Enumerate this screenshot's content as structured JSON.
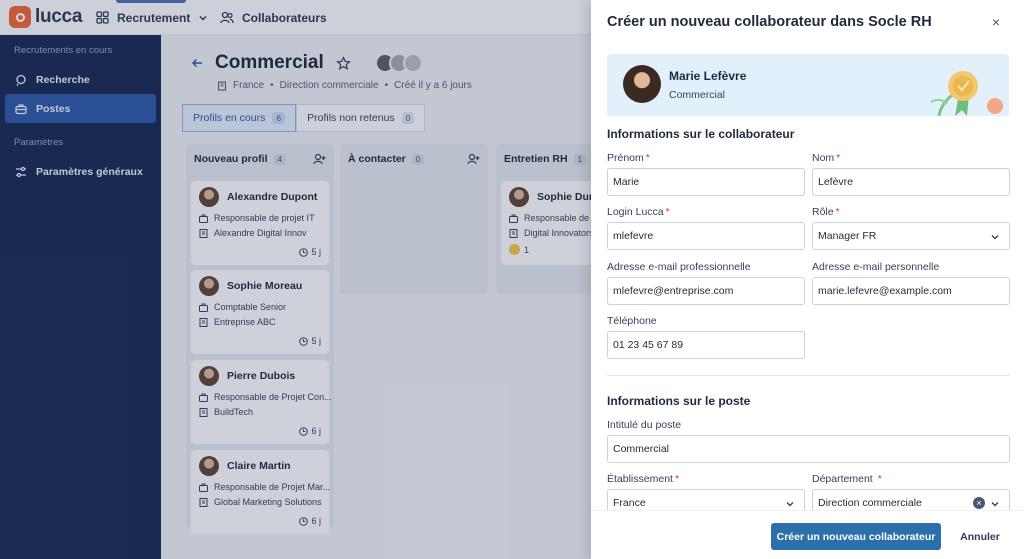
{
  "topbar": {
    "logo_text": "lucca",
    "nav_recruitment": "Recrutement",
    "nav_collaborators": "Collaborateurs"
  },
  "sidebar": {
    "section_1": "Recrutements en cours",
    "items_1": [
      {
        "label": "Recherche",
        "icon": "search-icon"
      },
      {
        "label": "Postes",
        "icon": "briefcase-icon",
        "active": true
      }
    ],
    "section_2": "Paramètres",
    "items_2": [
      {
        "label": "Paramètres généraux",
        "icon": "settings-icon"
      }
    ]
  },
  "page": {
    "title": "Commercial",
    "sub_country": "France",
    "sub_department": "Direction commerciale",
    "sub_created": "Créé il y a 6 jours",
    "tabs": [
      {
        "label": "Profils en cours",
        "count": "6"
      },
      {
        "label": "Profils non retenus",
        "count": "0"
      }
    ]
  },
  "board": {
    "columns": [
      {
        "title": "Nouveau profil",
        "count": "4"
      },
      {
        "title": "À contacter",
        "count": "0"
      },
      {
        "title": "Entretien RH",
        "count": "1"
      }
    ],
    "cards": [
      {
        "name": "Alexandre Dupont",
        "role": "Responsable de projet IT",
        "company": "Alexandre Digital Innov",
        "duration": "5 j"
      },
      {
        "name": "Sophie Moreau",
        "role": "Comptable Senior",
        "company": "Entreprise ABC",
        "duration": "5 j"
      },
      {
        "name": "Pierre Dubois",
        "role": "Responsable de Projet Con...",
        "company": "BuildTech",
        "duration": "6 j"
      },
      {
        "name": "Claire Martin",
        "role": "Responsable de Projet Mar...",
        "company": "Global Marketing Solutions",
        "duration": "6 j"
      },
      {
        "name": "Sophie Dura",
        "role": "Responsable de P",
        "company": "Digital Innovators",
        "reaction_count": "1"
      }
    ]
  },
  "panel": {
    "title": "Créer un nouveau collaborateur dans Socle RH",
    "banner_name": "Marie Lefèvre",
    "banner_position": "Commercial",
    "section_employee": "Informations sur le collaborateur",
    "section_job": "Informations sur le poste",
    "fields": {
      "first_name": {
        "label": "Prénom",
        "value": "Marie"
      },
      "last_name": {
        "label": "Nom",
        "value": "Lefèvre"
      },
      "login": {
        "label": "Login Lucca",
        "value": "mlefevre"
      },
      "role": {
        "label": "Rôle",
        "value": "Manager FR"
      },
      "pro_email": {
        "label": "Adresse e-mail professionnelle",
        "value": "mlefevre@entreprise.com"
      },
      "personal_email": {
        "label": "Adresse e-mail personnelle",
        "value": "marie.lefevre@example.com"
      },
      "phone": {
        "label": "Téléphone",
        "value": "01 23 45 67 89"
      },
      "job_title": {
        "label": "Intitulé du poste",
        "value": "Commercial"
      },
      "establishment": {
        "label": "Établissement",
        "value": "France"
      },
      "department": {
        "label": "Département",
        "value": "Direction commerciale"
      }
    },
    "required_mark": "*",
    "submit_label": "Créer un nouveau collaborateur",
    "cancel_label": "Annuler",
    "close_glyph": "×"
  },
  "colors": {
    "sidebar_bg": "#1a2a55",
    "sidebar_active": "#2f58a6",
    "primary_button": "#2b6fab",
    "banner_bg": "#e2f0fb",
    "required": "#d9383a"
  }
}
